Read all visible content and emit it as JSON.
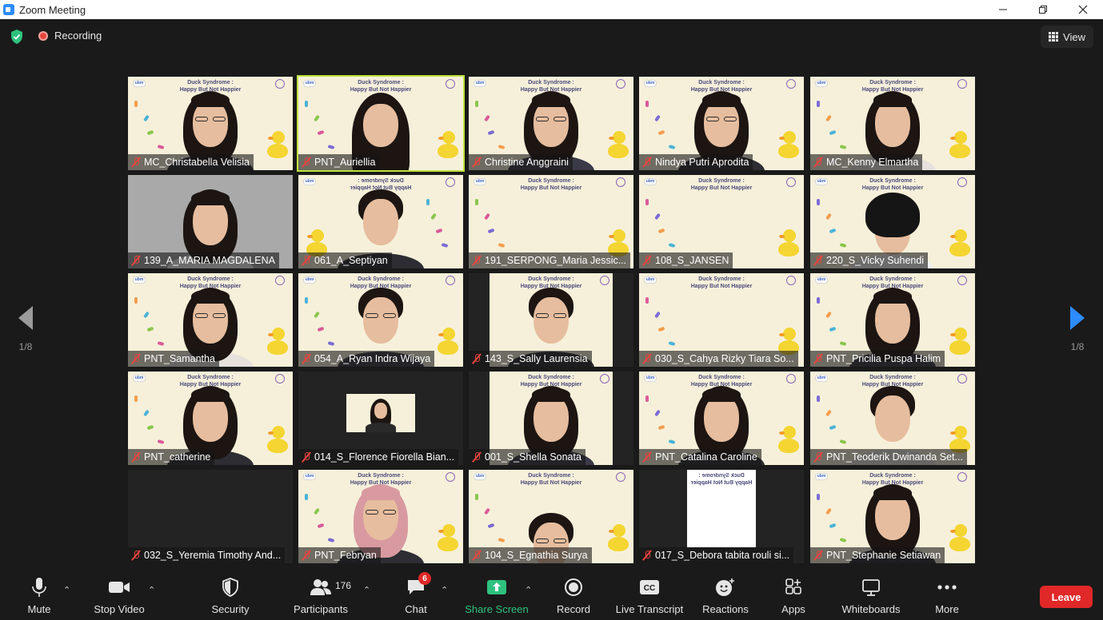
{
  "window": {
    "title": "Zoom Meeting"
  },
  "topbar": {
    "recording_label": "Recording",
    "view_label": "View"
  },
  "pagination": {
    "left": "1/8",
    "right": "1/8"
  },
  "banner": {
    "line1": "Duck Syndrome :",
    "line2": "Happy But Not Happier",
    "logo": "ubm"
  },
  "participants_tiles": [
    {
      "name": "MC_Christabella Velisia"
    },
    {
      "name": "PNT_Auriellia"
    },
    {
      "name": "Christine Anggraini"
    },
    {
      "name": "Nindya Putri Aprodita"
    },
    {
      "name": "MC_Kenny Elmartha"
    },
    {
      "name": "139_A_MARIA MAGDALENA"
    },
    {
      "name": "061_A_Septiyan"
    },
    {
      "name": "191_SERPONG_Maria Jessic..."
    },
    {
      "name": "108_S_JANSEN"
    },
    {
      "name": "220_S_Vicky Suhendi"
    },
    {
      "name": "PNT_Samantha"
    },
    {
      "name": "054_A_Ryan Indra Wijaya"
    },
    {
      "name": "143_S_Sally Laurensia"
    },
    {
      "name": "030_S_Cahya Rizky Tiara So..."
    },
    {
      "name": "PNT_Pricilia Puspa Halim"
    },
    {
      "name": "PNT_catherine"
    },
    {
      "name": "014_S_Florence Fiorella Bian..."
    },
    {
      "name": "001_S_Shella Sonata"
    },
    {
      "name": "PNT_Catalina Caroline"
    },
    {
      "name": "PNT_Teoderik Dwinanda Set..."
    },
    {
      "name": "032_S_Yeremia Timothy And..."
    },
    {
      "name": "PNT_Febryan"
    },
    {
      "name": "104_S_Egnathia Surya"
    },
    {
      "name": "017_S_Debora tabita rouli si..."
    },
    {
      "name": "PNT_Stephanie Setiawan"
    }
  ],
  "toolbar": {
    "mute": "Mute",
    "stop_video": "Stop Video",
    "security": "Security",
    "participants": "Participants",
    "participants_count": "176",
    "chat": "Chat",
    "chat_badge": "6",
    "share_screen": "Share Screen",
    "record": "Record",
    "live_transcript": "Live Transcript",
    "cc": "CC",
    "reactions": "Reactions",
    "apps": "Apps",
    "whiteboards": "Whiteboards",
    "more": "More",
    "leave": "Leave"
  },
  "colors": {
    "accent": "#2d8cff",
    "leave": "#e02828",
    "share": "#2ec27e",
    "active_speaker": "#bfe33a"
  }
}
